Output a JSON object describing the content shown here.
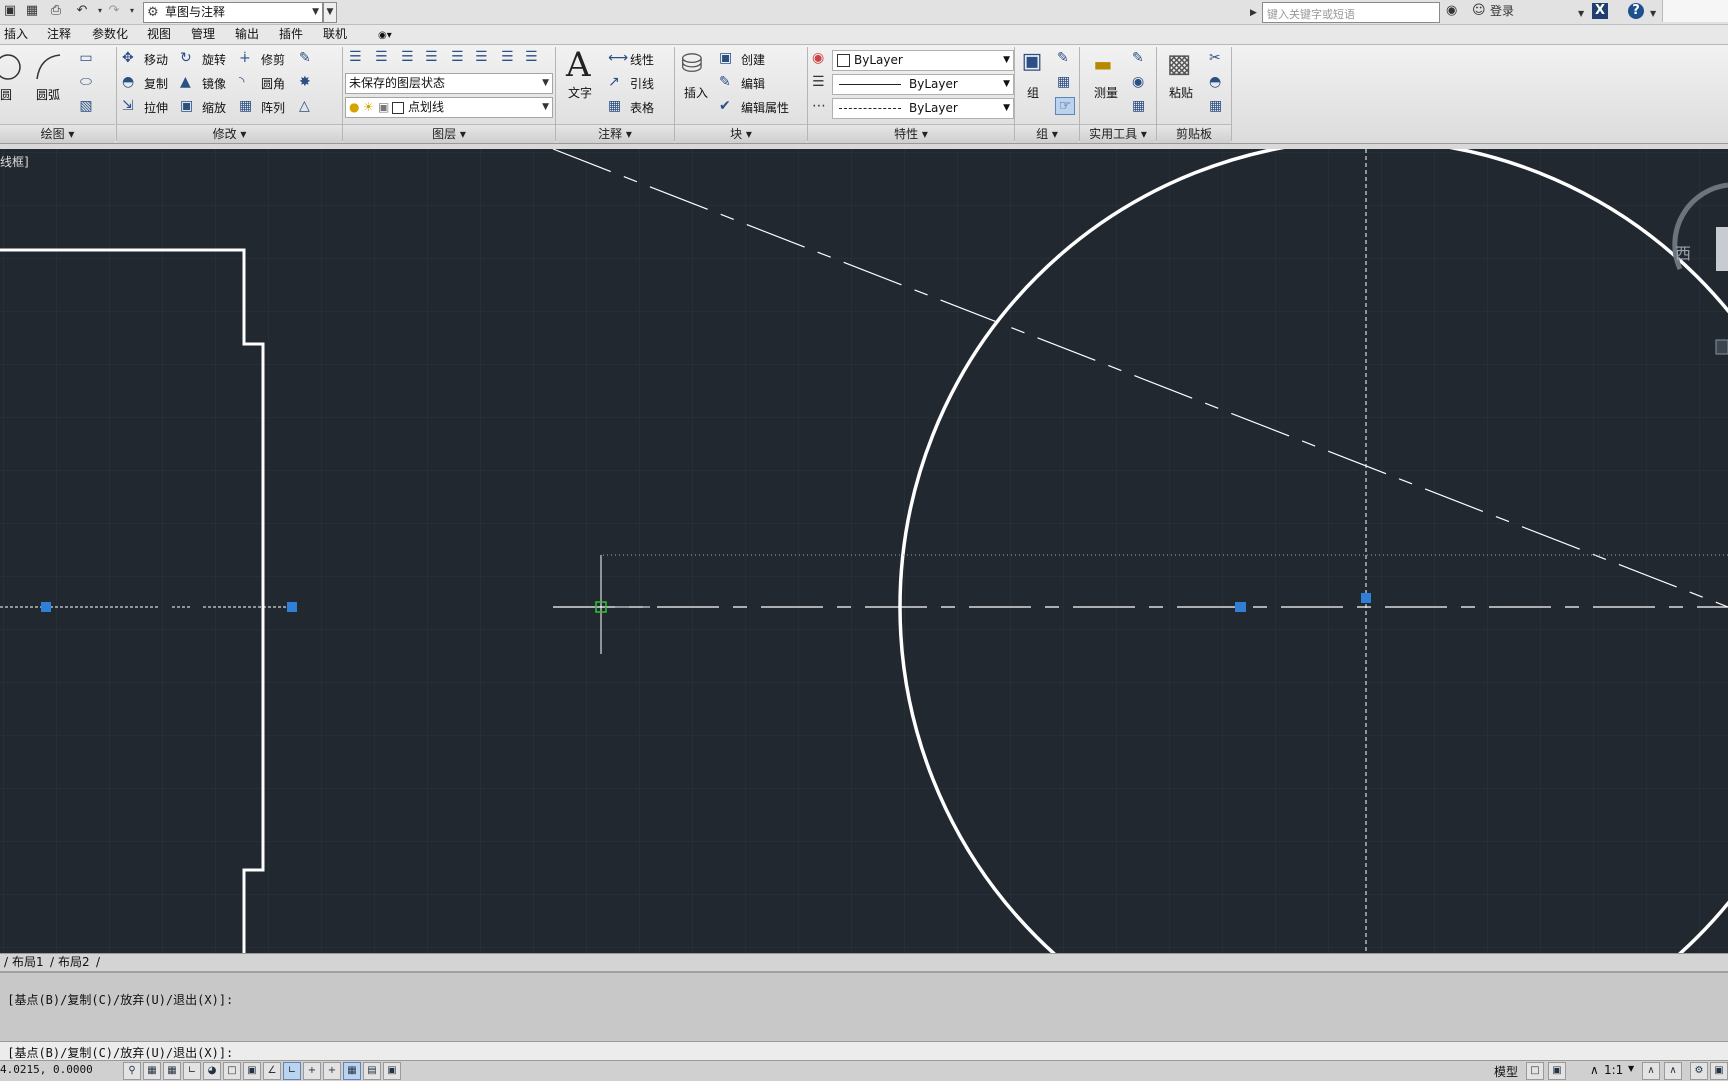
{
  "workspace": {
    "name": "草图与注释"
  },
  "search": {
    "placeholder": "键入关键字或短语"
  },
  "user": {
    "login": "登录"
  },
  "menu": [
    "插入",
    "注释",
    "参数化",
    "视图",
    "管理",
    "输出",
    "插件",
    "联机"
  ],
  "ribbon": {
    "draw": {
      "circle": "圆",
      "arc": "圆弧",
      "title": "绘图"
    },
    "modify": {
      "move": "移动",
      "rotate": "旋转",
      "trim": "修剪",
      "copy": "复制",
      "mirror": "镜像",
      "fillet": "圆角",
      "stretch": "拉伸",
      "scale": "缩放",
      "array": "阵列",
      "title": "修改"
    },
    "layers": {
      "state": "未保存的图层状态",
      "current": "点划线",
      "title": "图层"
    },
    "annotation": {
      "text": "文字",
      "linear": "线性",
      "leader": "引线",
      "table": "表格",
      "title": "注释"
    },
    "block": {
      "insert": "插入",
      "create": "创建",
      "edit": "编辑",
      "edit_attr": "编辑属性",
      "title": "块"
    },
    "properties": {
      "color": "ByLayer",
      "lineweight": "ByLayer",
      "linetype": "ByLayer",
      "title": "特性"
    },
    "groups": {
      "group": "组",
      "title": "组"
    },
    "utilities": {
      "measure": "测量",
      "title": "实用工具"
    },
    "clipboard": {
      "paste": "粘贴",
      "title": "剪贴板"
    }
  },
  "view": {
    "label": "线框]",
    "compass_west": "西"
  },
  "layout_tabs": [
    "布局1",
    "布局2"
  ],
  "command": {
    "history": "或 [基点(B)/复制(C)/放弃(U)/退出(X)]:",
    "current": "或 [基点(B)/复制(C)/放弃(U)/退出(X)]:"
  },
  "status": {
    "coords": "4.0215, 0.0000",
    "model": "模型",
    "scale": "1:1"
  },
  "colors": {
    "canvas": "#212830",
    "grip": "#2f7fd6",
    "geometry": "#ffffff"
  }
}
